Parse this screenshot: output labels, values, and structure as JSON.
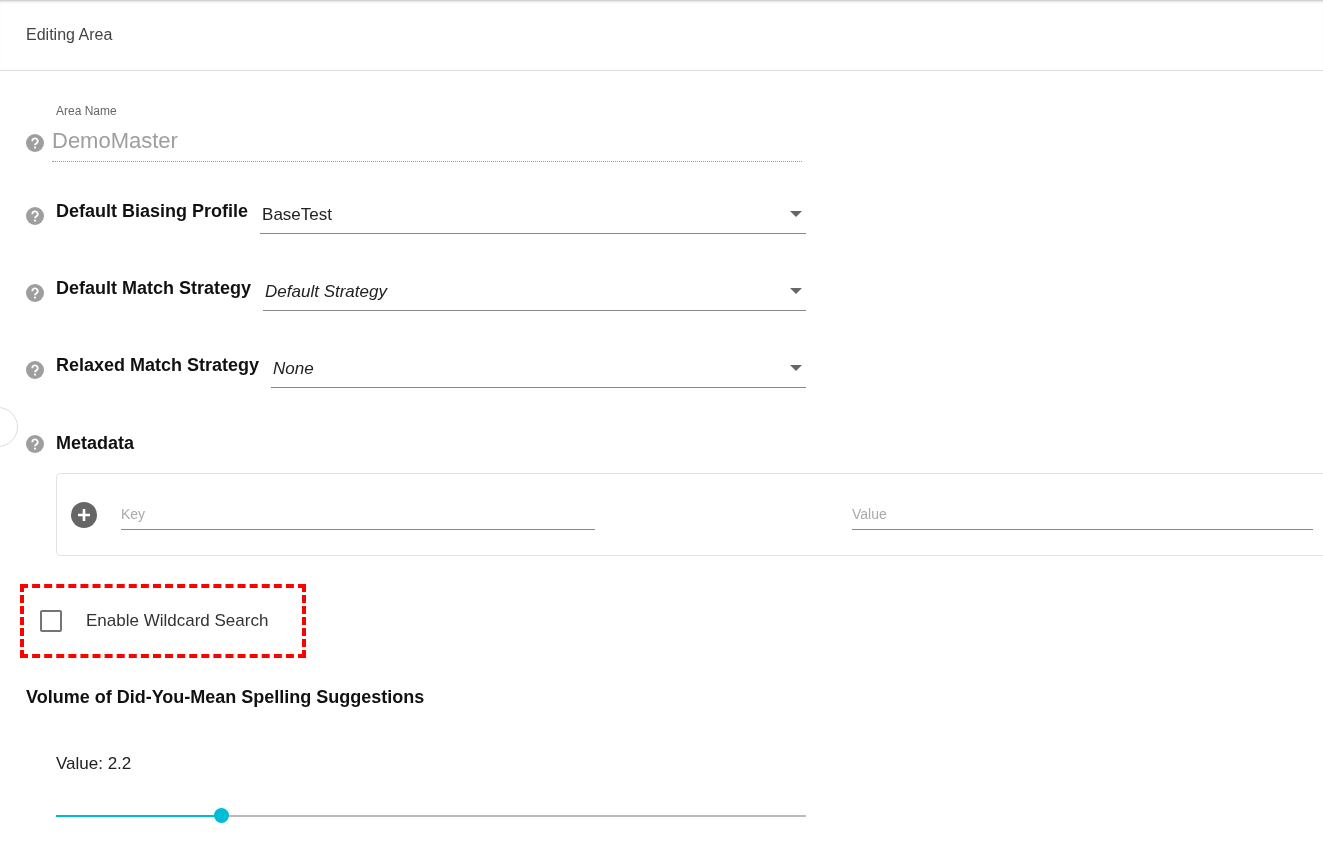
{
  "header": {
    "title": "Editing Area"
  },
  "area_name": {
    "label": "Area Name",
    "value": "DemoMaster",
    "disabled": true
  },
  "selects": [
    {
      "label": "Default Biasing Profile",
      "value": "BaseTest",
      "italic": false
    },
    {
      "label": "Default Match Strategy",
      "value": "Default Strategy",
      "italic": true
    },
    {
      "label": "Relaxed Match Strategy",
      "value": "None",
      "italic": true
    }
  ],
  "metadata": {
    "label": "Metadata",
    "key_placeholder": "Key",
    "value_placeholder": "Value"
  },
  "wildcard": {
    "label": "Enable Wildcard Search",
    "checked": false,
    "highlighted": true
  },
  "spelling": {
    "title": "Volume of Did-You-Mean Spelling Suggestions",
    "reading": "Value: 2.2",
    "level": 0.22
  }
}
